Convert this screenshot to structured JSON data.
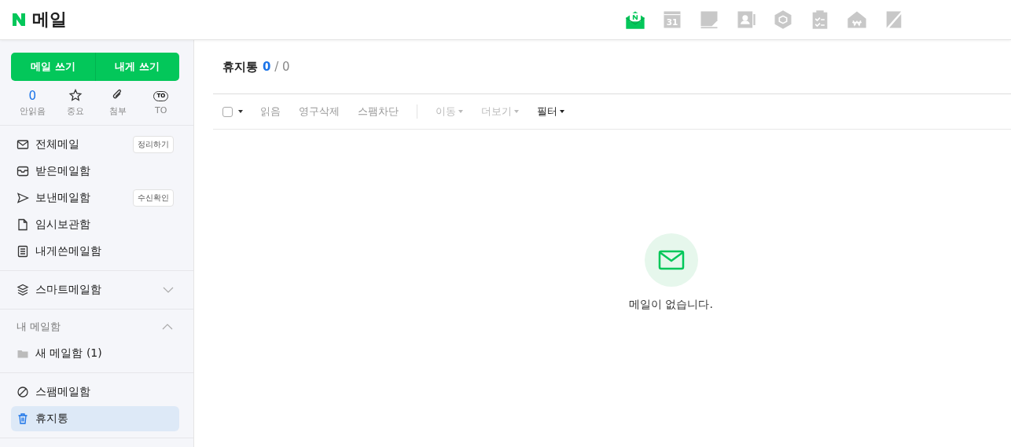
{
  "header": {
    "app_name": "메일",
    "apps": [
      {
        "selected": true
      },
      {
        "label": "31",
        "selected": false
      },
      {
        "selected": false
      },
      {
        "selected": false
      },
      {
        "selected": false
      },
      {
        "selected": false
      },
      {
        "selected": false
      },
      {
        "selected": false
      }
    ]
  },
  "sidebar": {
    "compose_buttons": [
      "메일 쓰기",
      "내게 쓰기"
    ],
    "quick_filters": [
      {
        "kind": "count",
        "count": "0",
        "label": "안읽음"
      },
      {
        "kind": "icon",
        "label": "중요"
      },
      {
        "kind": "icon",
        "label": "첨부"
      },
      {
        "kind": "icon",
        "label": "TO",
        "icon_text": "TO"
      }
    ],
    "groups": [
      {
        "items": [
          {
            "label": "전체메일",
            "action": "정리하기",
            "selected": false
          },
          {
            "label": "받은메일함",
            "selected": false
          },
          {
            "label": "보낸메일함",
            "action": "수신확인",
            "selected": false
          },
          {
            "label": "임시보관함",
            "selected": false
          },
          {
            "label": "내게쓴메일함",
            "selected": false
          }
        ]
      },
      {
        "items": [
          {
            "label": "스마트메일함",
            "expanded": false,
            "selected": false
          }
        ]
      },
      {
        "title": "내 메일함",
        "expanded": true,
        "items": [
          {
            "label": "새 메일함 (1)",
            "selected": false
          }
        ]
      },
      {
        "items": [
          {
            "label": "스팸메일함",
            "selected": false
          },
          {
            "label": "휴지통",
            "selected": true
          }
        ]
      }
    ]
  },
  "main": {
    "title": "휴지통",
    "unread": "0",
    "separator": "/",
    "total": "0",
    "toolbar": [
      {
        "label": "읽음",
        "disabled": false,
        "caret": false,
        "emphasized": false
      },
      {
        "label": "영구삭제",
        "disabled": false,
        "caret": false,
        "emphasized": false
      },
      {
        "label": "스팸차단",
        "disabled": false,
        "caret": false,
        "emphasized": false
      },
      {
        "label": "이동",
        "disabled": true,
        "caret": true,
        "emphasized": false
      },
      {
        "label": "더보기",
        "disabled": true,
        "caret": true,
        "emphasized": false
      },
      {
        "label": "필터",
        "disabled": false,
        "caret": true,
        "emphasized": true
      }
    ],
    "select_all": {
      "checked": false
    },
    "empty_message": "메일이 없습니다."
  }
}
